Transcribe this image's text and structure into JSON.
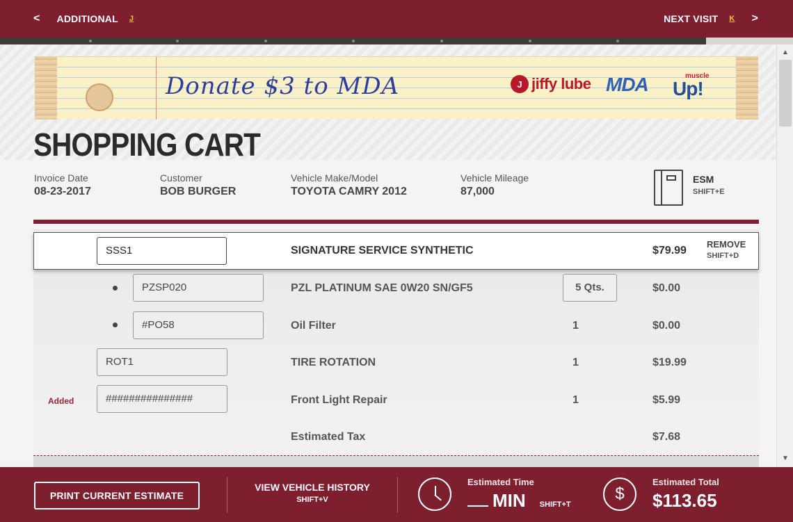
{
  "topbar": {
    "prev_label": "ADDITIONAL",
    "prev_hotkey": "J",
    "next_label": "NEXT VISIT",
    "next_hotkey": "K",
    "prev_chevron": "<",
    "next_chevron": ">"
  },
  "progress": {
    "fraction": 0.89
  },
  "banner": {
    "text": "Donate $3 to MDA",
    "logo_jiffy_mark": "J",
    "logo_jiffy_text": "jiffy lube",
    "logo_mda": "MDA",
    "logo_muscle_small": "muscle",
    "logo_muscle_big": "Up!"
  },
  "page_title": "SHOPPING CART",
  "info": {
    "invoice_label": "Invoice Date",
    "invoice_value": "08-23-2017",
    "customer_label": "Customer",
    "customer_value": "BOB BURGER",
    "vehicle_label": "Vehicle Make/Model",
    "vehicle_value": "TOYOTA CAMRY 2012",
    "mileage_label": "Vehicle Mileage",
    "mileage_value": "87,000"
  },
  "esm": {
    "label": "ESM",
    "shortcut": "SHIFT+E"
  },
  "cart": {
    "selected": {
      "code": "SSS1",
      "description": "SIGNATURE SERVICE SYNTHETIC",
      "price": "$79.99",
      "remove_label": "REMOVE",
      "remove_shortcut": "SHIFT+D"
    },
    "rows": [
      {
        "code": "PZSP020",
        "description": "PZL PLATINUM SAE 0W20 SN/GF5",
        "qty": "5 Qts.",
        "price": "$0.00"
      },
      {
        "code": "#PO58",
        "description": "Oil Filter",
        "qty": "1",
        "price": "$0.00"
      },
      {
        "code": "ROT1",
        "description": "TIRE ROTATION",
        "qty": "1",
        "price": "$19.99"
      },
      {
        "code": "###############",
        "description": "Front Light Repair",
        "qty": "1",
        "price": "$5.99",
        "tag": "Added"
      }
    ],
    "tax_label": "Estimated Tax",
    "tax_value": "$7.68"
  },
  "bottombar": {
    "print_label": "PRINT CURRENT ESTIMATE",
    "history_label": "VIEW VEHICLE HISTORY",
    "history_shortcut": "SHIFT+V",
    "time_label": "Estimated Time",
    "time_unit": "MIN",
    "time_shortcut": "SHIFT+T",
    "total_label": "Estimated Total",
    "total_value": "$113.65",
    "dollar_glyph": "$"
  },
  "icons": {
    "book": "book-icon",
    "clock": "clock-icon",
    "dollar": "dollar-icon"
  },
  "colors": {
    "brand": "#7d1f2f",
    "accent_hotkey": "#f7c12a",
    "added": "#9a2233"
  }
}
